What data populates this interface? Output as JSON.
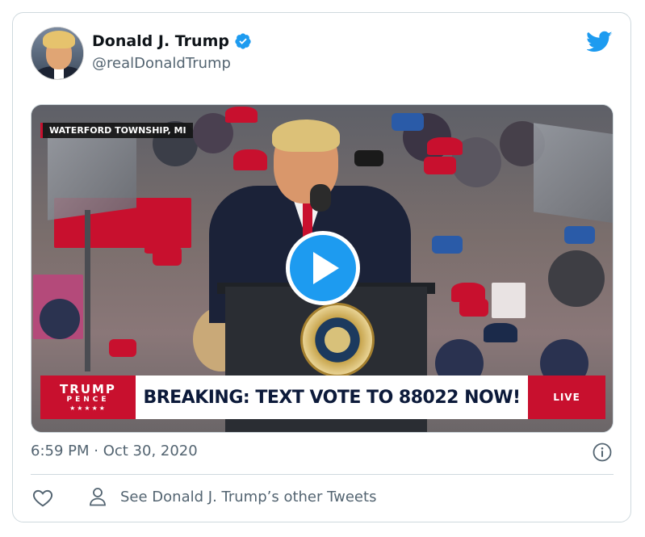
{
  "tweet": {
    "display_name": "Donald J. Trump",
    "handle": "@realDonaldTrump",
    "timestamp": "6:59 PM · Oct 30, 2020",
    "other_tweets_label": "See Donald J. Trump’s other Tweets"
  },
  "video": {
    "location_tag": "WATERFORD TOWNSHIP, MI",
    "banner_logo_line1": "TRUMP",
    "banner_logo_line2": "PENCE",
    "banner_logo_stars": "★★★★★",
    "banner_headline": "BREAKING: TEXT VOTE TO 88022 NOW!",
    "banner_live": "LIVE"
  },
  "icons": {
    "verified": "verified-badge-icon",
    "brand": "twitter-bird-icon",
    "info": "info-icon",
    "like": "heart-icon",
    "profile": "person-icon",
    "play": "play-icon"
  },
  "colors": {
    "accent": "#1d9bf0",
    "muted_text": "#536471",
    "border": "#cfd9de",
    "banner_red": "#c8102e"
  }
}
